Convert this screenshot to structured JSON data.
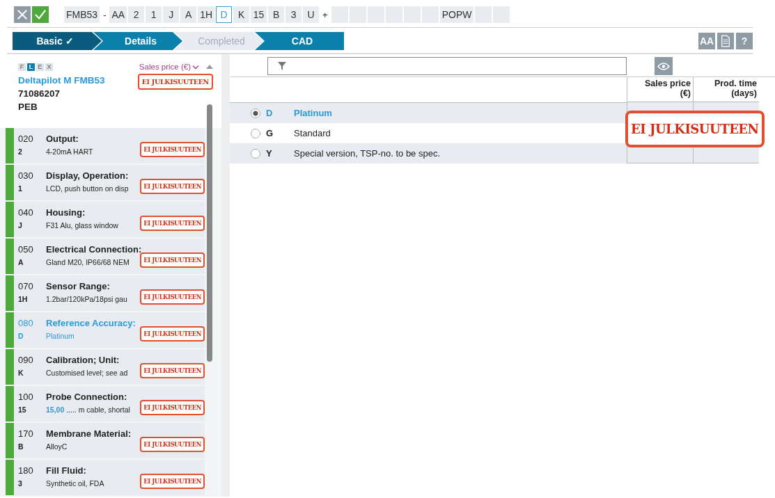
{
  "code_bar": {
    "chips": [
      {
        "label": "FMB53",
        "kind": "chip",
        "selected": false
      },
      {
        "label": "-",
        "kind": "sep"
      },
      {
        "label": "AA",
        "kind": "chip",
        "selected": false
      },
      {
        "label": "2",
        "kind": "chip",
        "selected": false
      },
      {
        "label": "1",
        "kind": "chip",
        "selected": false
      },
      {
        "label": "J",
        "kind": "chip",
        "selected": false
      },
      {
        "label": "A",
        "kind": "chip",
        "selected": false
      },
      {
        "label": "1H",
        "kind": "chip",
        "selected": false
      },
      {
        "label": "D",
        "kind": "chip",
        "selected": true
      },
      {
        "label": "K",
        "kind": "chip",
        "selected": false
      },
      {
        "label": "15",
        "kind": "chip",
        "selected": false
      },
      {
        "label": "B",
        "kind": "chip",
        "selected": false
      },
      {
        "label": "3",
        "kind": "chip",
        "selected": false
      },
      {
        "label": "U",
        "kind": "chip",
        "selected": false
      },
      {
        "label": "+",
        "kind": "sep"
      },
      {
        "kind": "empty"
      },
      {
        "kind": "empty"
      },
      {
        "kind": "empty"
      },
      {
        "kind": "empty"
      },
      {
        "kind": "empty"
      },
      {
        "kind": "empty"
      },
      {
        "label": "POPW",
        "kind": "chip",
        "selected": false
      },
      {
        "kind": "empty"
      },
      {
        "kind": "empty"
      }
    ]
  },
  "steps": [
    {
      "label": "Basic ✓",
      "kind": "done"
    },
    {
      "label": "Details",
      "kind": "open"
    },
    {
      "label": "Completed",
      "kind": "locked"
    },
    {
      "label": "CAD",
      "kind": "open"
    }
  ],
  "toolbar": {
    "font_button": "AA",
    "help_button": "?"
  },
  "sidebar": {
    "flex": [
      {
        "label": "F",
        "selected": false
      },
      {
        "label": "L",
        "selected": true
      },
      {
        "label": "E",
        "selected": false
      },
      {
        "label": "X",
        "selected": false
      }
    ],
    "price_selector": "Sales price (€)",
    "product_name": "Deltapilot M FMB53",
    "product_number": "71086207",
    "product_code": "PEB",
    "stamp": "EI JULKISUUTEEN",
    "items": [
      {
        "number": "020",
        "title": "Output:",
        "code": "2",
        "value": "4-20mA HART",
        "stamp": "EI JULKISUUTEEN",
        "selected": false
      },
      {
        "number": "030",
        "title": "Display, Operation:",
        "code": "1",
        "value": "LCD, push button on disp",
        "stamp": "EI JULKISUUTEEN",
        "selected": false
      },
      {
        "number": "040",
        "title": "Housing:",
        "code": "J",
        "value": "F31 Alu, glass window",
        "stamp": "EI JULKISUUTEEN",
        "selected": false
      },
      {
        "number": "050",
        "title": "Electrical Connection:",
        "code": "A",
        "value": "Gland M20, IP66/68 NEM",
        "stamp": "EI JULKISUUTEEN",
        "selected": false
      },
      {
        "number": "070",
        "title": "Sensor Range:",
        "code": "1H",
        "value": "1.2bar/120kPa/18psi gau",
        "stamp": "EI JULKISUUTEEN",
        "selected": false
      },
      {
        "number": "080",
        "title": "Reference Accuracy:",
        "code": "D",
        "value": "Platinum",
        "stamp": "EI JULKISUUTEEN",
        "selected": true
      },
      {
        "number": "090",
        "title": "Calibration; Unit:",
        "code": "K",
        "value": "Customised level; see ad",
        "stamp": "EI JULKISUUTEEN",
        "selected": false
      },
      {
        "number": "100",
        "title": "Probe Connection:",
        "code": "15",
        "value_highlight": "15,00",
        "value": "..... m cable, shortal",
        "stamp": "EI JULKISUUTEEN",
        "selected": false
      },
      {
        "number": "170",
        "title": "Membrane Material:",
        "code": "B",
        "value": "AlloyC",
        "stamp": "EI JULKISUUTEEN",
        "selected": false
      },
      {
        "number": "180",
        "title": "Fill Fluid:",
        "code": "3",
        "value": "Synthetic oil, FDA",
        "stamp": "EI JULKISUUTEEN",
        "selected": false
      }
    ]
  },
  "options": {
    "columns": [
      "Sales price (€)",
      "Prod. time (days)"
    ],
    "rows": [
      {
        "code": "D",
        "label": "Platinum",
        "selected": true
      },
      {
        "code": "G",
        "label": "Standard",
        "selected": false
      },
      {
        "code": "Y",
        "label": "Special version, TSP-no. to be spec.",
        "selected": false
      }
    ],
    "stamp": "EI JULKISUUTEEN"
  }
}
